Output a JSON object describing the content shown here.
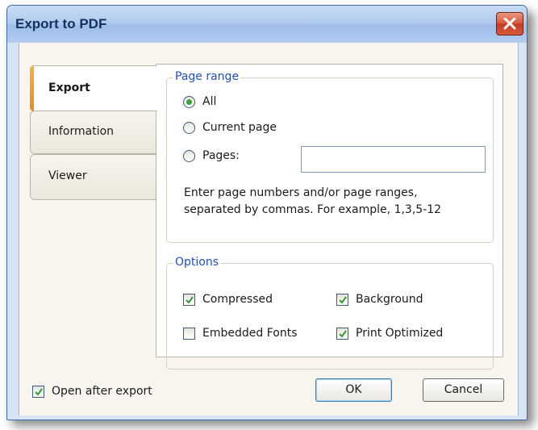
{
  "window": {
    "title": "Export to PDF"
  },
  "tabs": [
    {
      "label": "Export",
      "active": true
    },
    {
      "label": "Information",
      "active": false
    },
    {
      "label": "Viewer",
      "active": false
    }
  ],
  "page_range": {
    "legend": "Page range",
    "options": [
      {
        "label": "All",
        "selected": true
      },
      {
        "label": "Current page",
        "selected": false
      },
      {
        "label": "Pages:",
        "selected": false
      }
    ],
    "pages_value": "",
    "hint_line1": "Enter page numbers and/or page ranges,",
    "hint_line2": "separated by commas. For example, 1,3,5-12"
  },
  "options": {
    "legend": "Options",
    "compressed": {
      "label": "Compressed",
      "checked": true
    },
    "embedded_fonts": {
      "label": "Embedded Fonts",
      "checked": false
    },
    "background": {
      "label": "Background",
      "checked": true
    },
    "print_optimized": {
      "label": "Print Optimized",
      "checked": true
    }
  },
  "footer": {
    "open_after_export": {
      "label": "Open after export",
      "checked": true
    },
    "ok_label": "OK",
    "cancel_label": "Cancel"
  },
  "colors": {
    "accent_legend": "#1f4fc8",
    "check_mark": "#2e9e2e",
    "tab_accent": "#e88c1a"
  }
}
